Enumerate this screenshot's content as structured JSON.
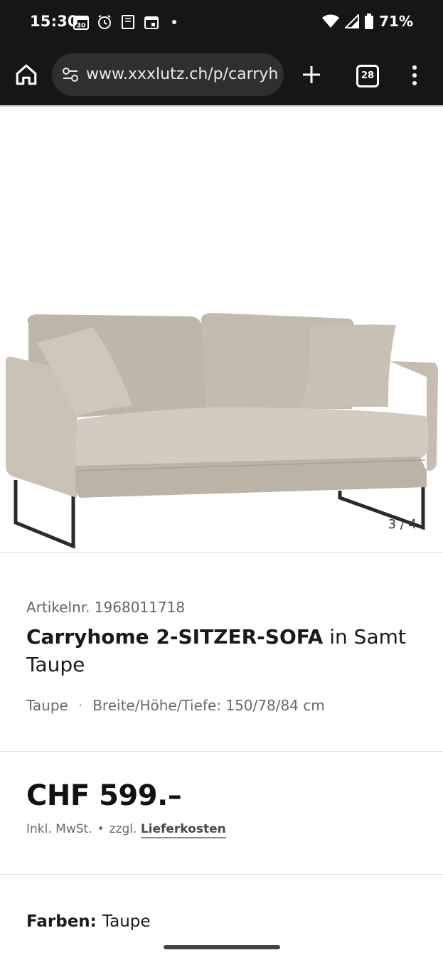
{
  "status_bar": {
    "time": "15:30",
    "calendar_day": "30",
    "battery": "71%"
  },
  "browser": {
    "url": "www.xxxlutz.ch/p/carryh",
    "tab_count": "28"
  },
  "gallery": {
    "counter": "3 / 4",
    "image_alt": "sofa-product-image"
  },
  "product": {
    "article_number": "Artikelnr. 1968011718",
    "title_bold": "Carryhome 2-SITZER-SOFA",
    "title_rest": " in Samt Taupe",
    "color": "Taupe",
    "dimensions": "Breite/Höhe/Tiefe: 150/78/84 cm",
    "price": "CHF 599.–",
    "tax_note": "Inkl. MwSt.",
    "shipping_prefix": "zzgl.",
    "shipping_link": "Lieferkosten",
    "colors_label": "Farben:",
    "colors_value": "Taupe"
  },
  "colors": {
    "status_bg": "#161616",
    "url_bg": "#2f2f31",
    "sofa": "#c8bfb3"
  }
}
